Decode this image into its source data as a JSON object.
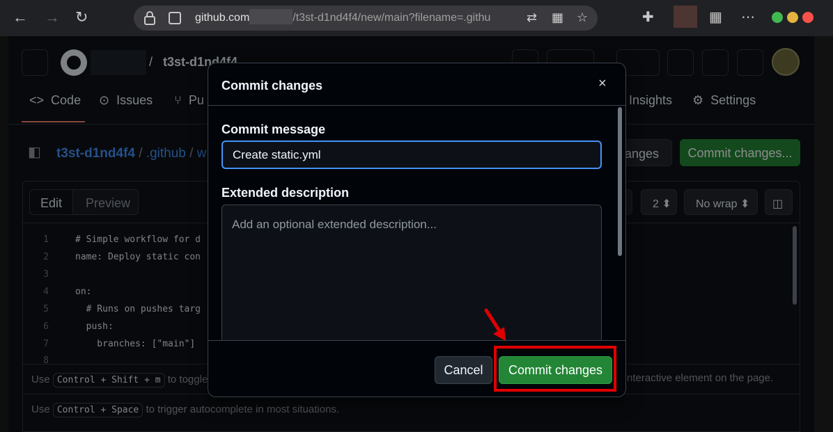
{
  "browser": {
    "url_host": "github.com",
    "url_rest": "/t3st-d1nd4f4/new/main?filename=.githu"
  },
  "header": {
    "repo_name": "t3st-d1nd4f4"
  },
  "repo_tabs": [
    {
      "label": "Code"
    },
    {
      "label": "Issues"
    },
    {
      "label": "Pu"
    },
    {
      "label": "Insights"
    },
    {
      "label": "Settings"
    }
  ],
  "file_path": {
    "repo": "t3st-d1nd4f4",
    "folder": ".github",
    "rest": "w"
  },
  "page_buttons": {
    "cancel_partial": "hanges",
    "commit": "Commit changes..."
  },
  "editor": {
    "edit_tab": "Edit",
    "preview_tab": "Preview",
    "indent": "2",
    "wrap": "No wrap",
    "lines": [
      {
        "n": "1",
        "text": "# Simple workflow for d"
      },
      {
        "n": "2",
        "text": "name: Deploy static con"
      },
      {
        "n": "3",
        "text": ""
      },
      {
        "n": "4",
        "text": "on:"
      },
      {
        "n": "5",
        "text": "  # Runs on pushes targ"
      },
      {
        "n": "6",
        "text": "  push:"
      },
      {
        "n": "7",
        "text": "    branches: [\"main\"]"
      },
      {
        "n": "8",
        "text": ""
      }
    ],
    "hint1_pre": "Use",
    "hint1_kbd": "Control + Shift + m",
    "hint1_post": "to toggle",
    "hint1_right": "nteractive element on the page.",
    "hint2_pre": "Use",
    "hint2_kbd": "Control + Space",
    "hint2_post": "to trigger autocomplete in most situations."
  },
  "modal": {
    "title": "Commit changes",
    "close": "×",
    "message_label": "Commit message",
    "message_value": "Create static.yml",
    "description_label": "Extended description",
    "description_placeholder": "Add an optional extended description...",
    "cancel_label": "Cancel",
    "commit_label": "Commit changes"
  },
  "colors": {
    "accent_blue": "#4493f8",
    "primary_green": "#238636",
    "highlight_red": "#e00000"
  }
}
